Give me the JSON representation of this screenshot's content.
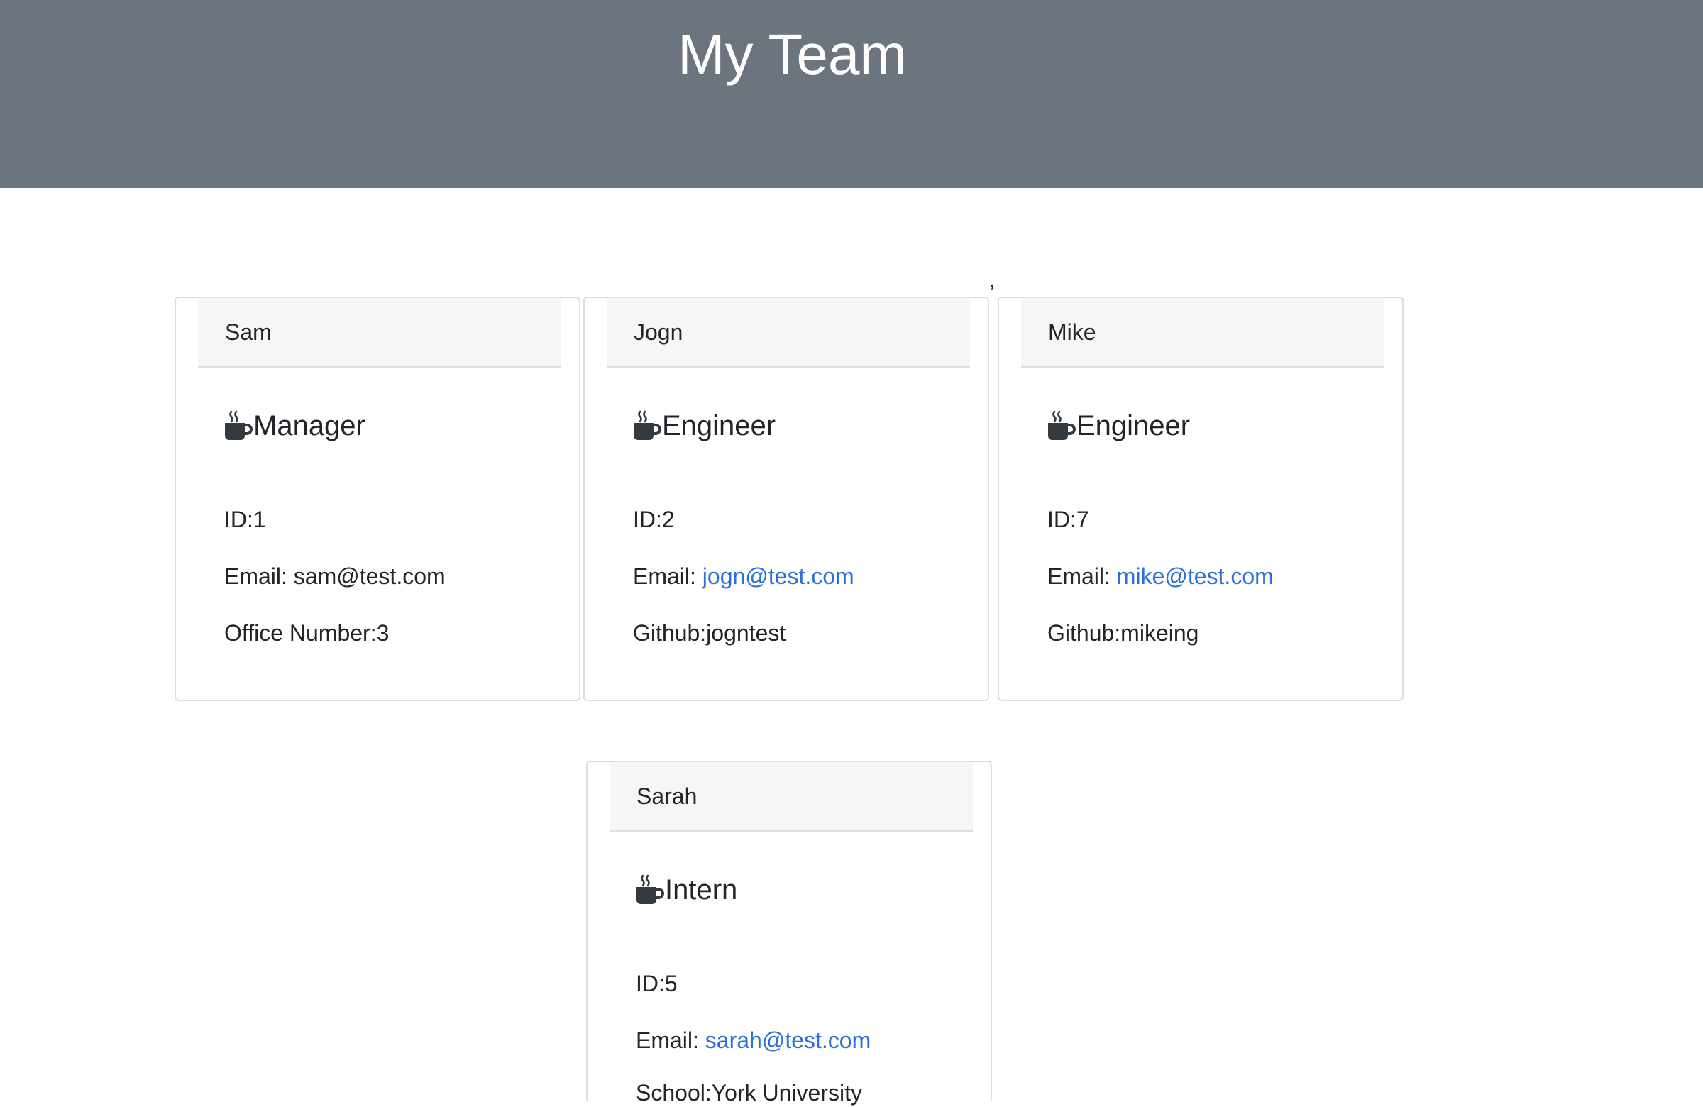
{
  "header": {
    "title": "My Team"
  },
  "stray_mark": ",",
  "cards": [
    {
      "name": "Sam",
      "role": "Manager",
      "id_label": "ID:1",
      "email_prefix": "Email: ",
      "email": "sam@test.com",
      "extra": "Office Number:3"
    },
    {
      "name": "Jogn",
      "role": "Engineer",
      "id_label": "ID:2",
      "email_prefix": "Email: ",
      "email": "jogn@test.com",
      "extra": "Github:jogntest"
    },
    {
      "name": "Mike",
      "role": "Engineer",
      "id_label": "ID:7",
      "email_prefix": "Email: ",
      "email": "mike@test.com",
      "extra": "Github:mikeing"
    },
    {
      "name": "Sarah",
      "role": "Intern",
      "id_label": "ID:5",
      "email_prefix": "Email: ",
      "email": "sarah@test.com",
      "extra": "School:York University"
    }
  ],
  "icons": {
    "role_icon": "mug-hot-icon"
  },
  "colors": {
    "header_bg": "#6c757d",
    "link": "#2a6fdb",
    "card_header_bg": "#f6f6f6"
  }
}
